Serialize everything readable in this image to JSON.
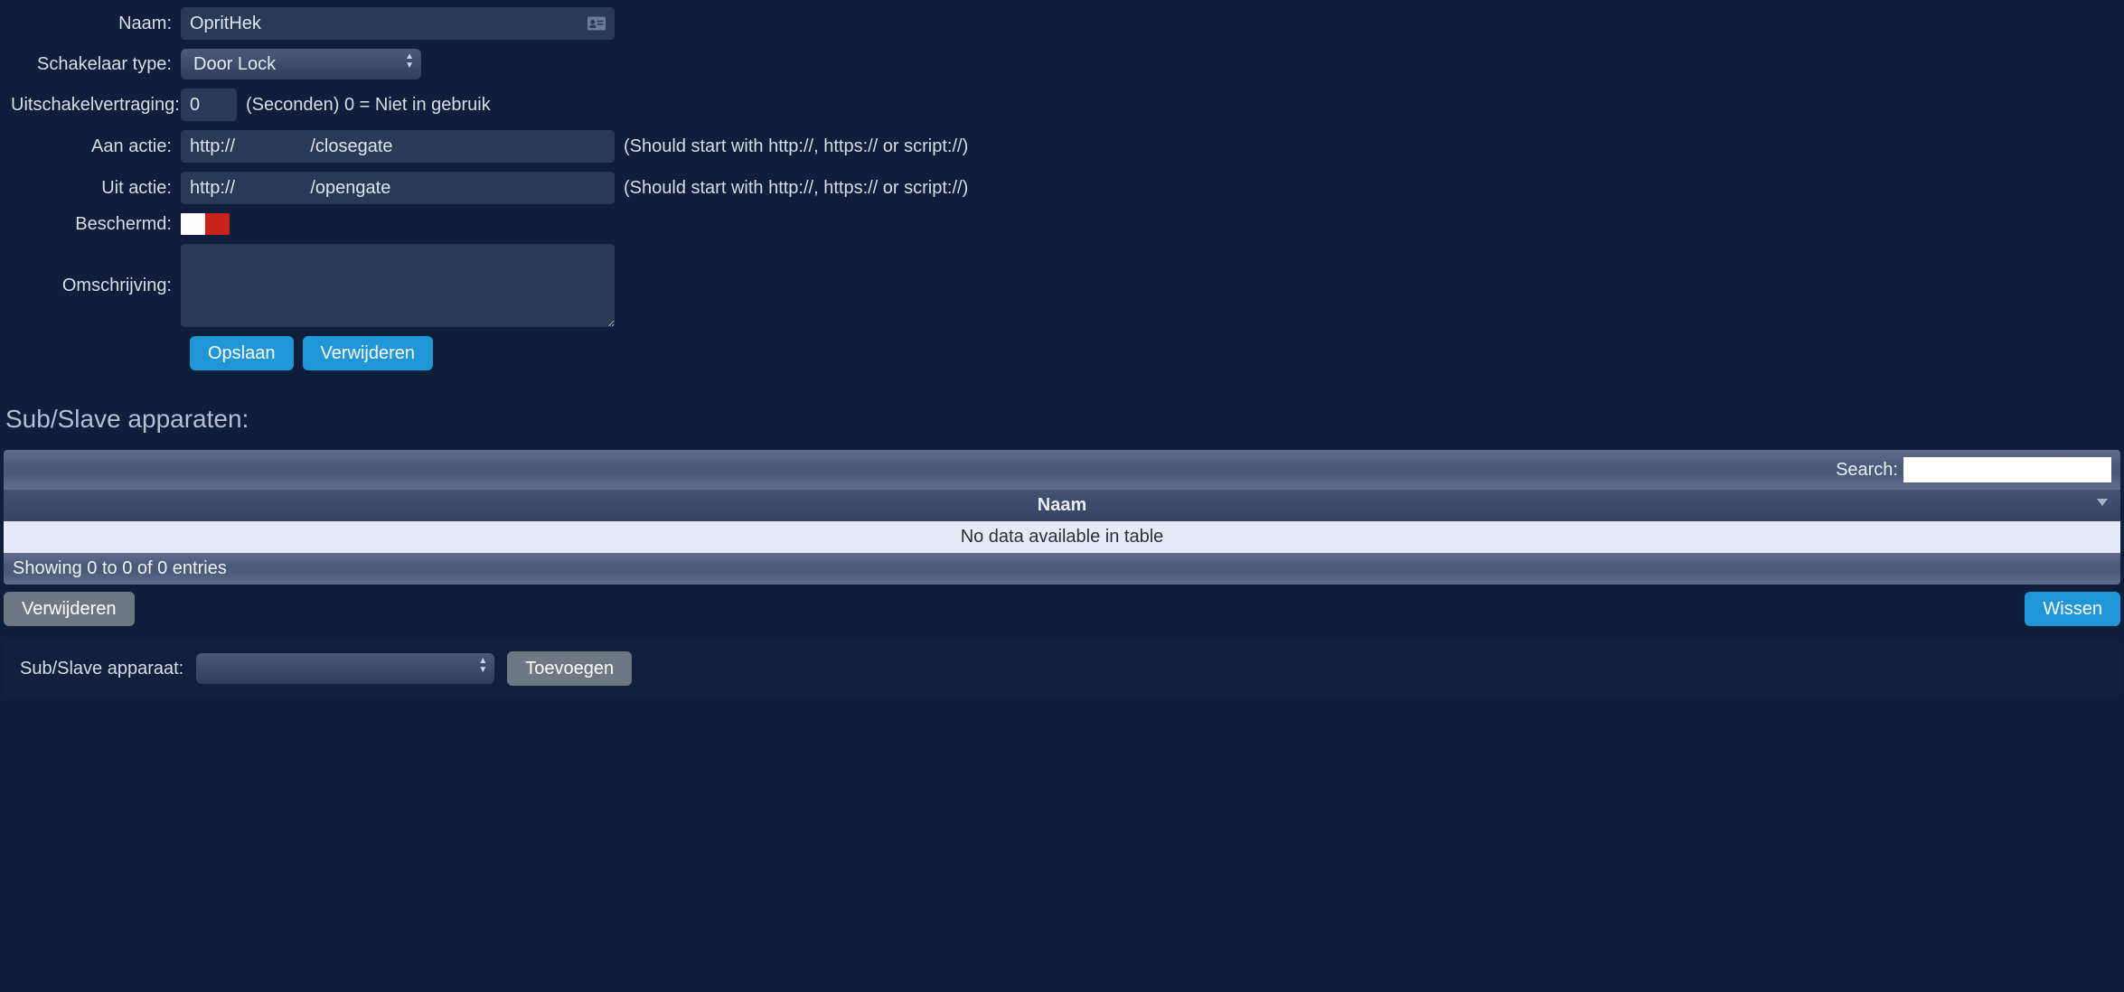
{
  "form": {
    "labels": {
      "naam": "Naam:",
      "schakelaar_type": "Schakelaar type:",
      "uitschakelvertraging": "Uitschakelvertraging:",
      "aan_actie": "Aan actie:",
      "uit_actie": "Uit actie:",
      "beschermd": "Beschermd:",
      "omschrijving": "Omschrijving:"
    },
    "values": {
      "naam": "OpritHek",
      "schakelaar_type": "Door Lock",
      "uitschakelvertraging": "0",
      "aan_actie": "http://               /closegate",
      "uit_actie": "http://               /opengate",
      "omschrijving": ""
    },
    "hints": {
      "uitschakelvertraging": "(Seconden) 0 = Niet in gebruik",
      "actie": "(Should start with http://, https:// or script://)"
    },
    "buttons": {
      "opslaan": "Opslaan",
      "verwijderen": "Verwijderen"
    }
  },
  "subslave": {
    "title": "Sub/Slave apparaten:",
    "search_label": "Search:",
    "search_value": "",
    "column_header": "Naam",
    "empty_text": "No data available in table",
    "info_text": "Showing 0 to 0 of 0 entries",
    "buttons": {
      "verwijderen": "Verwijderen",
      "wissen": "Wissen",
      "toevoegen": "Toevoegen"
    },
    "apparaat_label": "Sub/Slave apparaat:",
    "apparaat_value": ""
  }
}
